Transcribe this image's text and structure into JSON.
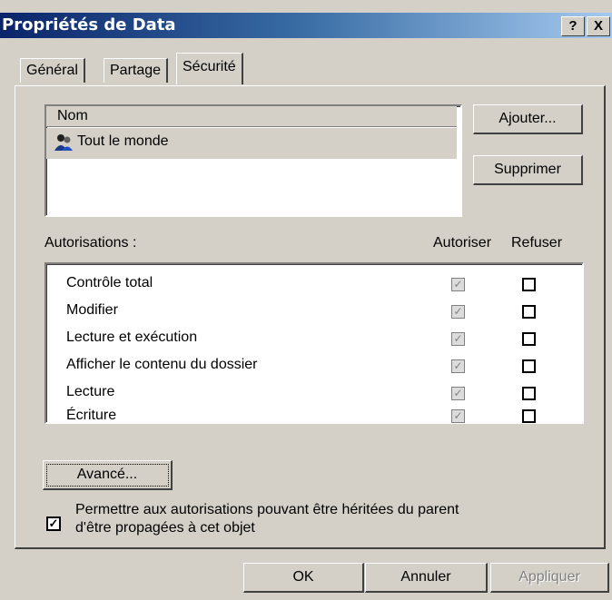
{
  "window": {
    "title": "Propriétés de Data",
    "help_btn": "?",
    "close_btn": "X"
  },
  "tabs": [
    {
      "label": "Général"
    },
    {
      "label": "Partage"
    },
    {
      "label": "Sécurité"
    }
  ],
  "users": {
    "column_header": "Nom",
    "items": [
      {
        "name": "Tout le monde",
        "icon": "group-users-icon"
      }
    ],
    "add_button": "Ajouter...",
    "remove_button": "Supprimer"
  },
  "permissions": {
    "label": "Autorisations :",
    "allow_header": "Autoriser",
    "deny_header": "Refuser",
    "rows": [
      {
        "label": "Contrôle total",
        "allow": true,
        "deny": false
      },
      {
        "label": "Modifier",
        "allow": true,
        "deny": false
      },
      {
        "label": "Lecture et exécution",
        "allow": true,
        "deny": false
      },
      {
        "label": "Afficher le contenu du dossier",
        "allow": true,
        "deny": false
      },
      {
        "label": "Lecture",
        "allow": true,
        "deny": false
      },
      {
        "label": "Écriture",
        "allow": true,
        "deny": false
      }
    ]
  },
  "advanced_button": "Avancé...",
  "inherit": {
    "checked": true,
    "line1": "Permettre aux autorisations pouvant être héritées du parent",
    "line2": "d'être propagées à cet objet"
  },
  "footer": {
    "ok": "OK",
    "cancel": "Annuler",
    "apply": "Appliquer"
  }
}
